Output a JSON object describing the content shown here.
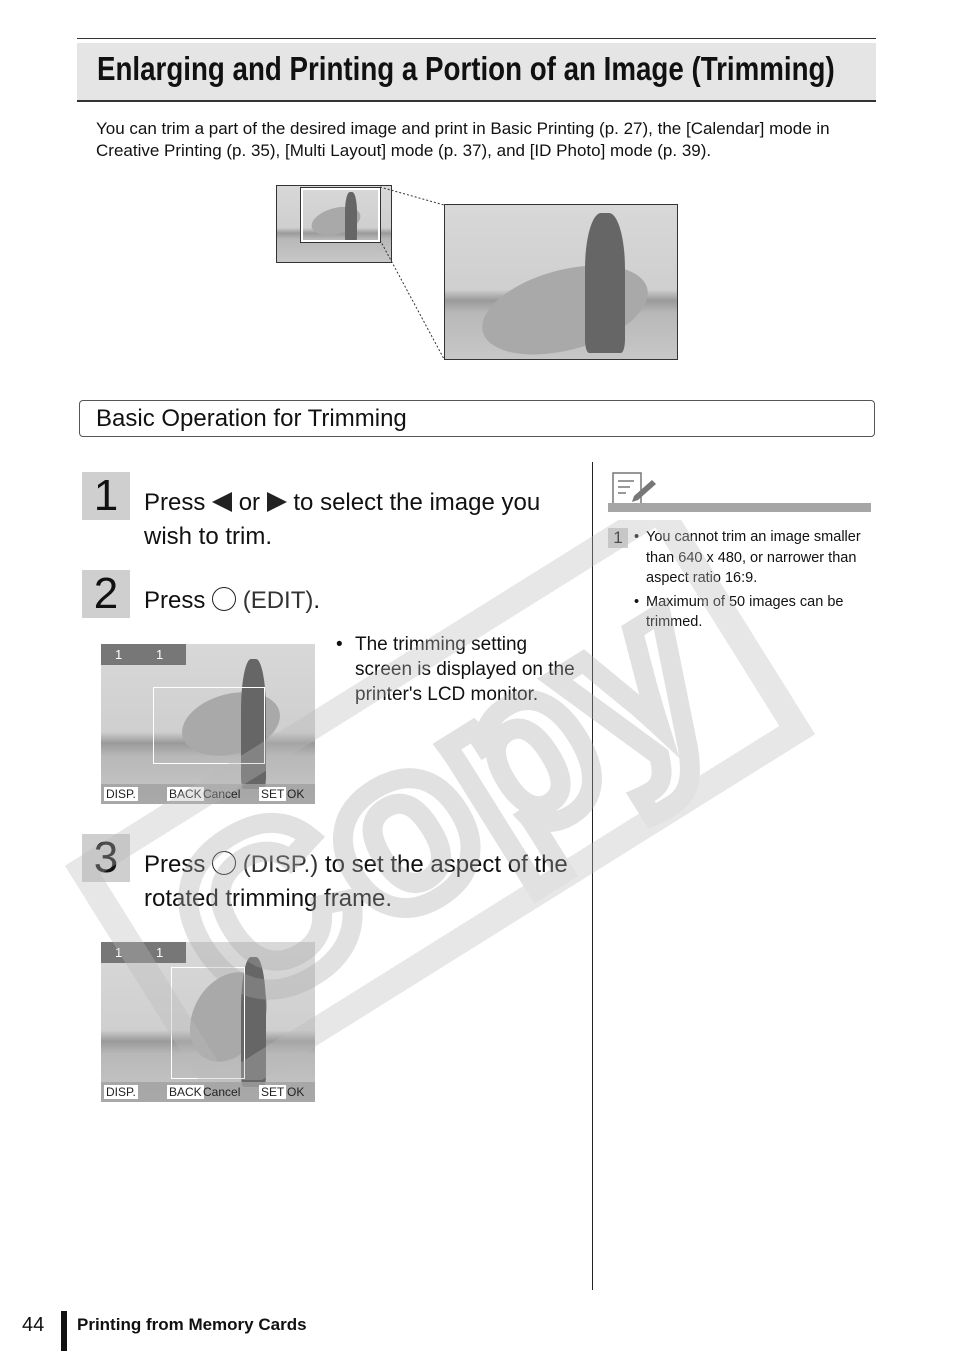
{
  "header": {
    "title": "Enlarging and Printing a Portion of an Image (Trimming)"
  },
  "intro": "You can trim a part of the desired image and print in Basic Printing (p. 27), the [Calendar] mode in Creative Printing (p. 35), [Multi Layout] mode (p. 37), and [ID Photo] mode (p. 39).",
  "section": {
    "title": "Basic Operation for Trimming"
  },
  "steps": [
    {
      "number": "1",
      "press": "Press",
      "or": "or",
      "text": "to select the image you wish to trim.",
      "icons": [
        "left-arrow-icon",
        "right-arrow-icon"
      ]
    },
    {
      "number": "2",
      "press": "Press",
      "button": "(EDIT)",
      "suffix": ".",
      "bullet": "The trimming setting screen is displayed on the printer's LCD monitor."
    },
    {
      "number": "3",
      "press": "Press",
      "button": "(DISP.)",
      "text": "to set the aspect of the rotated trimming frame."
    }
  ],
  "lcd": {
    "count": "1",
    "image_num": "1",
    "disp": "DISP.",
    "back": "BACK",
    "cancel": "Cancel",
    "set": "SET",
    "ok": "OK"
  },
  "note": {
    "number": "1",
    "bullets": [
      "You cannot trim an image smaller than 640 x 480, or narrower than aspect ratio 16:9.",
      "Maximum of 50 images can be trimmed."
    ]
  },
  "footer": {
    "page": "44",
    "chapter": "Printing from Memory Cards"
  },
  "watermark": "Copy"
}
